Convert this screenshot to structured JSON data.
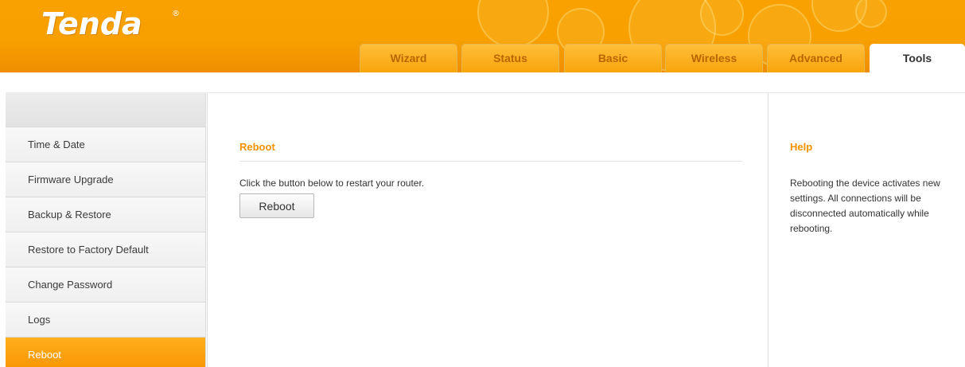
{
  "header": {
    "logo_text": "Tenda",
    "logo_mark": "®",
    "brand_color": "#f7a000"
  },
  "tabs": [
    {
      "label": "Wizard",
      "active": false
    },
    {
      "label": "Status",
      "active": false
    },
    {
      "label": "Basic",
      "active": false
    },
    {
      "label": "Wireless",
      "active": false
    },
    {
      "label": "Advanced",
      "active": false
    },
    {
      "label": "Tools",
      "active": true
    }
  ],
  "sidebar": {
    "items": [
      {
        "label": "Time & Date",
        "active": false
      },
      {
        "label": "Firmware Upgrade",
        "active": false
      },
      {
        "label": "Backup & Restore",
        "active": false
      },
      {
        "label": "Restore to Factory Default",
        "active": false
      },
      {
        "label": "Change Password",
        "active": false
      },
      {
        "label": "Logs",
        "active": false
      },
      {
        "label": "Reboot",
        "active": true
      }
    ]
  },
  "main": {
    "title": "Reboot",
    "description": "Click the button below to restart your router.",
    "button_label": "Reboot"
  },
  "help": {
    "title": "Help",
    "text": "Rebooting the device activates new settings. All connections will be disconnected automatically while rebooting."
  },
  "colors": {
    "accent": "#f39200",
    "active_item": "#f89400"
  }
}
